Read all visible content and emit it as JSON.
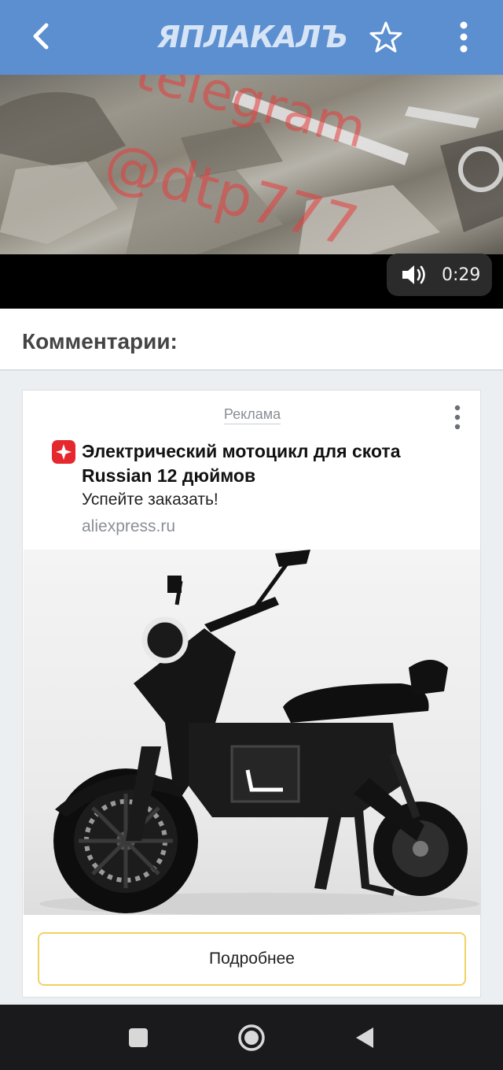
{
  "appbar": {
    "logo_text": "ЯПЛАКАЛЪ",
    "back_icon": "arrow-back-icon",
    "star_icon": "star-outline-icon",
    "menu_icon": "more-vertical-icon"
  },
  "video": {
    "watermark_line1": "telegram",
    "watermark_line2": "@dtp777",
    "duration": "0:29",
    "sound_icon": "volume-icon"
  },
  "comments": {
    "title": "Комментарии:"
  },
  "ad": {
    "label": "Реклама",
    "headline": "Электрический мотоцикл для скота Russian 12 дюймов",
    "subtitle": "Успейте заказать!",
    "domain": "aliexpress.ru",
    "cta": "Подробнее",
    "brand_icon": "aliexpress-icon"
  },
  "navbar": {
    "recents_icon": "square-icon",
    "home_icon": "circle-icon",
    "back_icon": "triangle-back-icon"
  },
  "colors": {
    "appbar": "#5b8fd0",
    "cta_border": "#f0d264",
    "brand_red": "#e5282d"
  }
}
